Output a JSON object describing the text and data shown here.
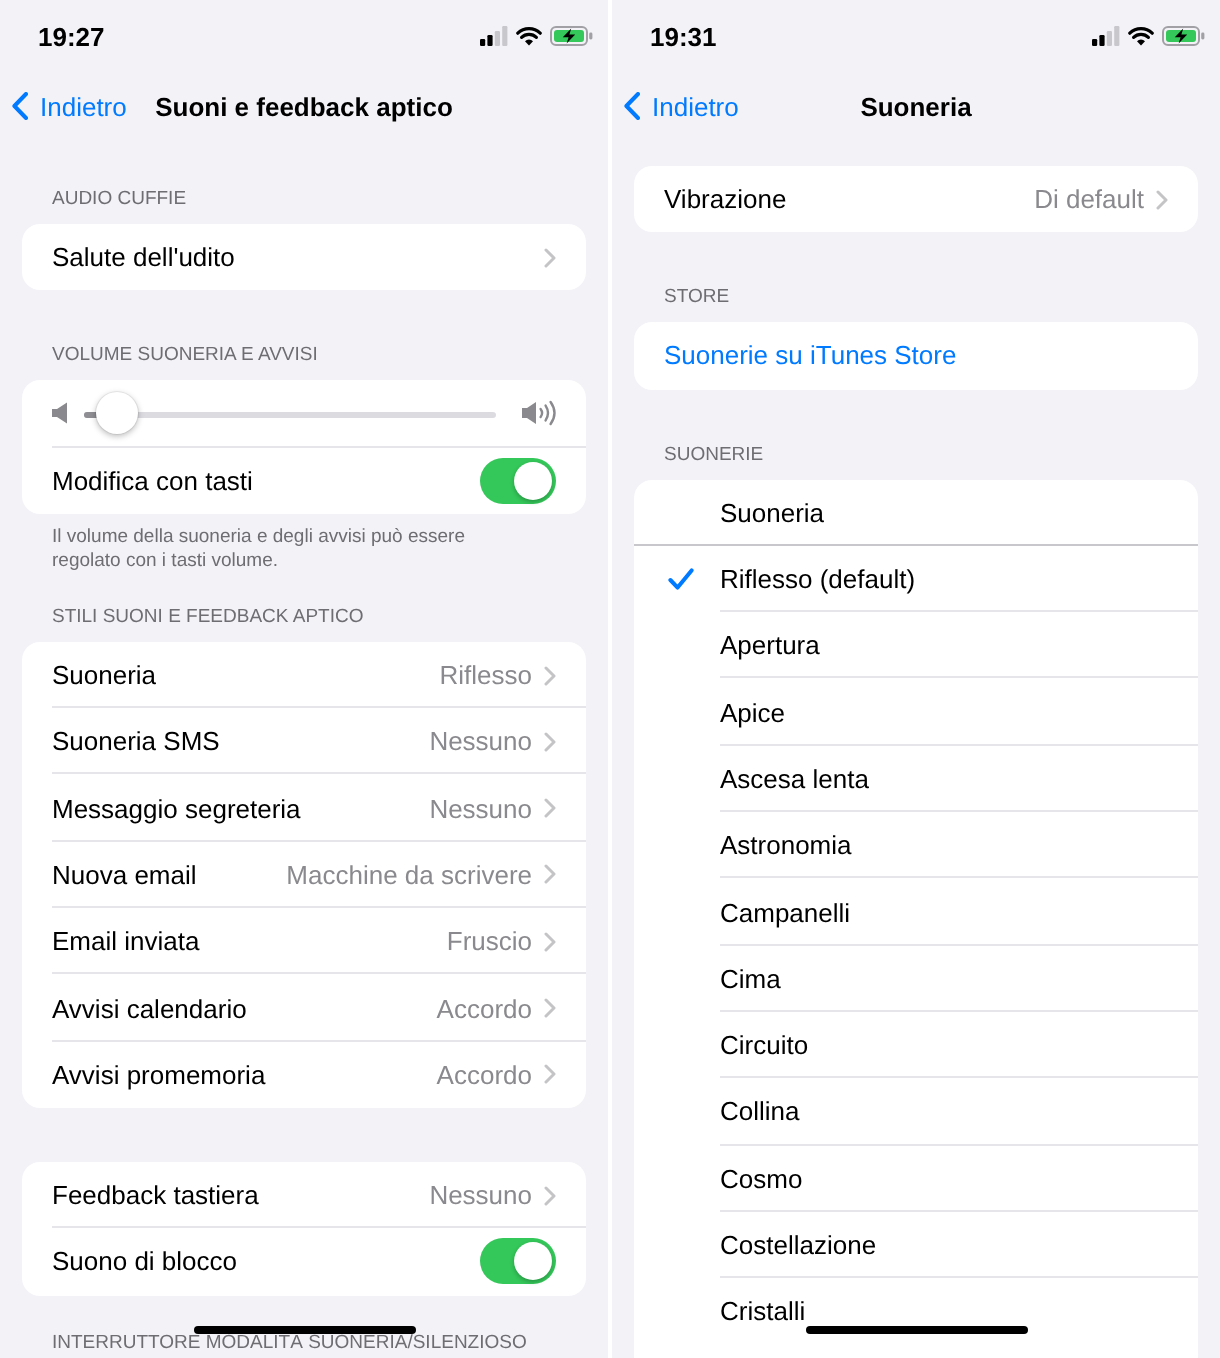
{
  "screens": [
    {
      "status_bar": {
        "time": "19:27"
      },
      "nav": {
        "back": "Indietro",
        "title": "Suoni e feedback aptico"
      },
      "sections": [
        {
          "header": "AUDIO CUFFIE",
          "rows": [
            {
              "kind": "link",
              "label": "Salute dell'udito"
            }
          ]
        },
        {
          "header": "VOLUME SUONERIA E AVVISI",
          "rows": [
            {
              "kind": "slider",
              "level": 0.03
            },
            {
              "kind": "toggle",
              "label": "Modifica con tasti",
              "on": true
            }
          ],
          "footer": "Il volume della suoneria e degli avvisi può essere regolato con i tasti volume."
        },
        {
          "header": "STILI SUONI E FEEDBACK APTICO",
          "rows": [
            {
              "kind": "link",
              "label": "Suoneria",
              "value": "Riflesso"
            },
            {
              "kind": "link",
              "label": "Suoneria SMS",
              "value": "Nessuno"
            },
            {
              "kind": "link",
              "label": "Messaggio segreteria",
              "value": "Nessuno"
            },
            {
              "kind": "link",
              "label": "Nuova email",
              "value": "Macchine da scrivere"
            },
            {
              "kind": "link",
              "label": "Email inviata",
              "value": "Fruscio"
            },
            {
              "kind": "link",
              "label": "Avvisi calendario",
              "value": "Accordo"
            },
            {
              "kind": "link",
              "label": "Avvisi promemoria",
              "value": "Accordo"
            }
          ]
        },
        {
          "rows": [
            {
              "kind": "link",
              "label": "Feedback tastiera",
              "value": "Nessuno"
            },
            {
              "kind": "toggle",
              "label": "Suono di blocco",
              "on": true
            }
          ]
        },
        {
          "header": "INTERRUTTORE MODALITÀ SUONERIA/SILENZIOSO"
        }
      ]
    },
    {
      "status_bar": {
        "time": "19:31"
      },
      "nav": {
        "back": "Indietro",
        "title": "Suoneria"
      },
      "sections": [
        {
          "rows": [
            {
              "kind": "link",
              "label": "Vibrazione",
              "value": "Di default"
            }
          ]
        },
        {
          "header": "STORE",
          "rows": [
            {
              "kind": "action",
              "label": "Suonerie su iTunes Store"
            }
          ]
        },
        {
          "header": "SUONERIE",
          "rows": [
            {
              "kind": "title",
              "label": "Suoneria"
            },
            {
              "kind": "choice",
              "label": "Riflesso (default)",
              "selected": true
            },
            {
              "kind": "choice",
              "label": "Apertura",
              "selected": false
            },
            {
              "kind": "choice",
              "label": "Apice",
              "selected": false
            },
            {
              "kind": "choice",
              "label": "Ascesa lenta",
              "selected": false
            },
            {
              "kind": "choice",
              "label": "Astronomia",
              "selected": false
            },
            {
              "kind": "choice",
              "label": "Campanelli",
              "selected": false
            },
            {
              "kind": "choice",
              "label": "Cima",
              "selected": false
            },
            {
              "kind": "choice",
              "label": "Circuito",
              "selected": false
            },
            {
              "kind": "choice",
              "label": "Collina",
              "selected": false
            },
            {
              "kind": "choice",
              "label": "Cosmo",
              "selected": false
            },
            {
              "kind": "choice",
              "label": "Costellazione",
              "selected": false
            },
            {
              "kind": "choice",
              "label": "Cristalli",
              "selected": false
            }
          ]
        }
      ]
    }
  ]
}
